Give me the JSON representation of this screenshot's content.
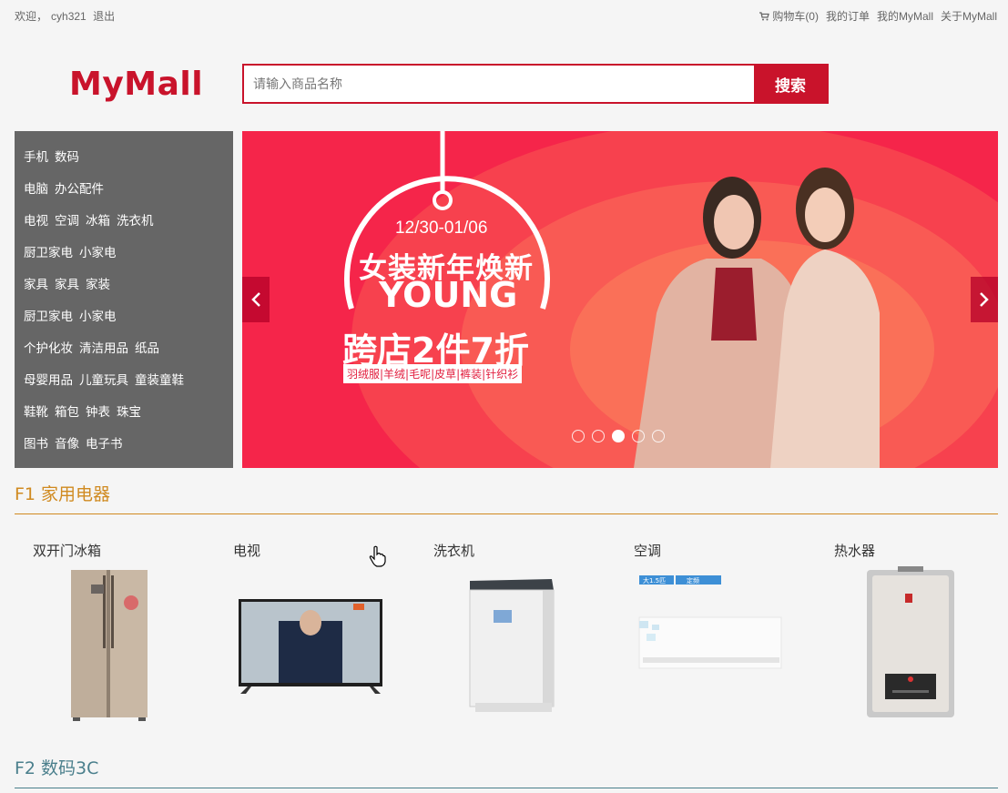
{
  "topbar": {
    "welcome": "欢迎，",
    "username": "cyh321",
    "logout": "退出",
    "cart": "购物车(0)",
    "orders": "我的订单",
    "my_mall": "我的MyMall",
    "about": "关于MyMall"
  },
  "header": {
    "logo": "MyMall",
    "search_placeholder": "请输入商品名称",
    "search_button": "搜索"
  },
  "categories": [
    [
      "手机",
      "数码"
    ],
    [
      "电脑",
      "办公配件"
    ],
    [
      "电视",
      "空调",
      "冰箱",
      "洗衣机"
    ],
    [
      "厨卫家电",
      "小家电"
    ],
    [
      "家具",
      "家具",
      "家装"
    ],
    [
      "厨卫家电",
      "小家电"
    ],
    [
      "个护化妆",
      "清洁用品",
      "纸品"
    ],
    [
      "母婴用品",
      "儿童玩具",
      "童装童鞋"
    ],
    [
      "鞋靴",
      "箱包",
      "钟表",
      "珠宝"
    ],
    [
      "图书",
      "音像",
      "电子书"
    ]
  ],
  "banner": {
    "date": "12/30-01/06",
    "title": "女装新年焕新",
    "subtitle": "YOUNG",
    "sale": "跨店2件7折",
    "tags": "羽绒服|羊绒|毛呢|皮草|裤装|针织衫",
    "slide_count": 5,
    "active_slide": 2,
    "prev_icon": "chevron-left-icon",
    "next_icon": "chevron-right-icon"
  },
  "floor1": {
    "title": "F1 家用电器",
    "color": "#d08a20",
    "products": [
      {
        "name": "双开门冰箱",
        "icon": "refrigerator"
      },
      {
        "name": "电视",
        "icon": "television"
      },
      {
        "name": "洗衣机",
        "icon": "washing-machine"
      },
      {
        "name": "空调",
        "icon": "air-conditioner",
        "badges": [
          "大1.5匹",
          "定频"
        ]
      },
      {
        "name": "热水器",
        "icon": "water-heater"
      }
    ]
  },
  "floor2": {
    "title": "F2 数码3C",
    "color": "#4a7f8c"
  },
  "colors": {
    "brand_red": "#c9132b",
    "banner_bg": "#f5254a",
    "menu_bg": "#666666"
  }
}
